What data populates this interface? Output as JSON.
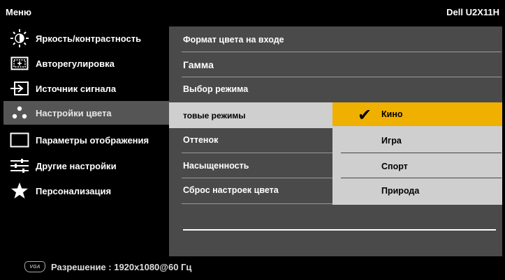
{
  "header": {
    "menu_title": "Меню",
    "model": "Dell U2X11H"
  },
  "sidebar": {
    "items": [
      {
        "label": "Яркость/контрастность",
        "icon": "brightness-icon"
      },
      {
        "label": "Авторегулировка",
        "icon": "auto-adjust-icon"
      },
      {
        "label": "Источник сигнала",
        "icon": "input-source-icon"
      },
      {
        "label": "Настройки цвета",
        "icon": "color-settings-icon",
        "active": true
      },
      {
        "label": "Параметры отображения",
        "icon": "display-settings-icon"
      },
      {
        "label": "Другие настройки",
        "icon": "other-settings-icon"
      },
      {
        "label": "Персонализация",
        "icon": "star-icon"
      }
    ]
  },
  "panel": {
    "options": [
      {
        "label": "Формат цвета на входе"
      },
      {
        "label": "Гамма"
      },
      {
        "label": "Выбор режима"
      },
      {
        "label": "товые режимы",
        "selected": true
      },
      {
        "label": "Оттенок"
      },
      {
        "label": "Насыщенность"
      },
      {
        "label": "Сброс настроек цвета"
      }
    ]
  },
  "submenu": {
    "items": [
      {
        "label": "Кино",
        "checked": true,
        "highlight": true
      },
      {
        "label": "Игра"
      },
      {
        "label": "Спорт"
      },
      {
        "label": "Природа"
      }
    ],
    "check_glyph": "✔"
  },
  "footer": {
    "icon_text": "VGA",
    "resolution": "Разрешение : 1920x1080@60 Гц"
  },
  "colors": {
    "highlight": "#f0b000",
    "panel_bg": "#4a4a4a",
    "selected_bg": "#cfcfcf",
    "active_sidebar": "#555555"
  }
}
